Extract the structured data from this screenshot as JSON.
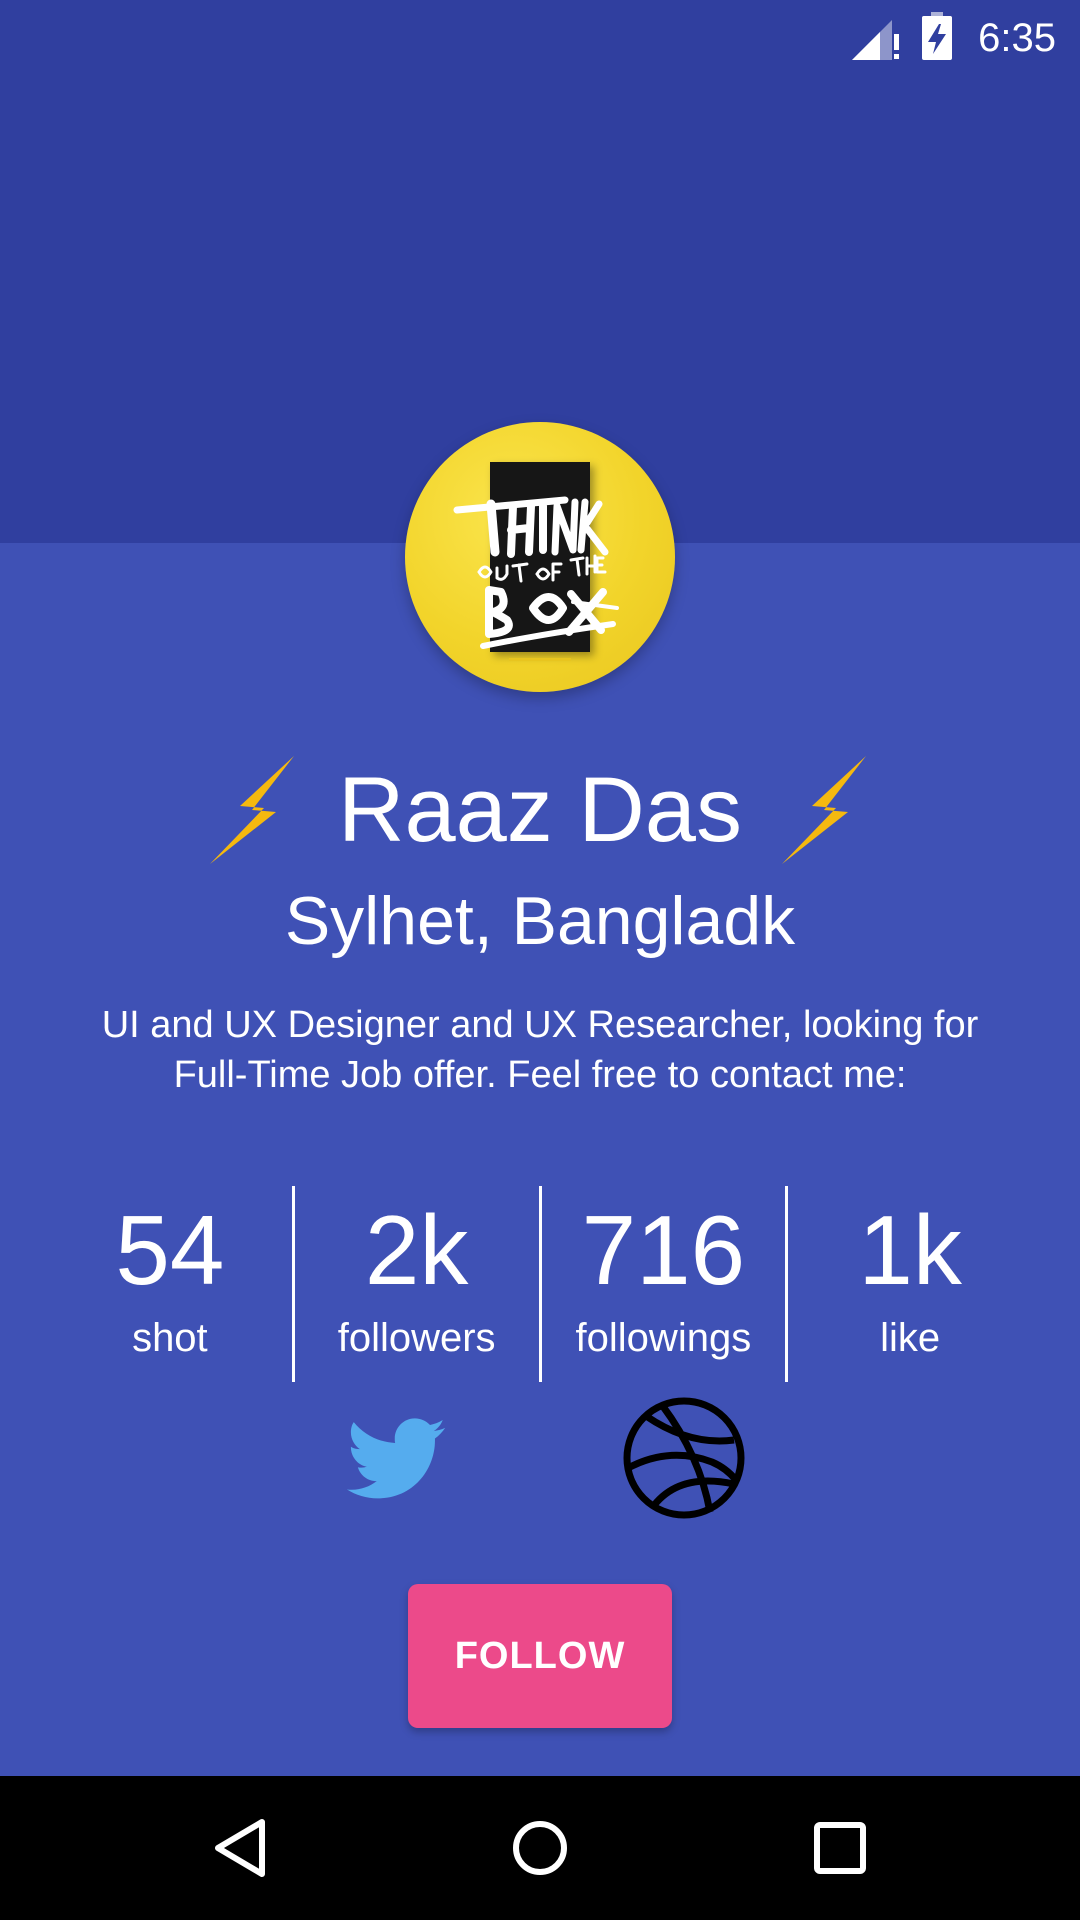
{
  "status_bar": {
    "time": "6:35",
    "icons": [
      "signal-no-data-icon",
      "battery-charging-icon"
    ]
  },
  "profile": {
    "avatar_icon": "think-out-of-the-box-avatar",
    "name": "Raaz Das",
    "name_decoration_icon": "lightning-bolt-icon",
    "location": "Sylhet, Bangladk",
    "bio": "UI and UX Designer and UX Researcher, looking for Full-Time Job offer. Feel free to contact me:"
  },
  "stats": [
    {
      "value": "54",
      "label": "shot"
    },
    {
      "value": "2k",
      "label": "followers"
    },
    {
      "value": "716",
      "label": "followings"
    },
    {
      "value": "1k",
      "label": "like"
    }
  ],
  "social": [
    {
      "icon": "twitter-icon",
      "color": "#55ACEE"
    },
    {
      "icon": "dribbble-icon",
      "color": "#000000"
    }
  ],
  "follow_button": {
    "label": "FOLLOW",
    "color": "#EC4A8A"
  },
  "nav_bar": {
    "icons": [
      "back-icon",
      "home-icon",
      "recents-icon"
    ]
  },
  "colors": {
    "header": "#303F9F",
    "background": "#3F51B5",
    "bolt": "#F5B90F",
    "avatar": "#F2D42A"
  }
}
